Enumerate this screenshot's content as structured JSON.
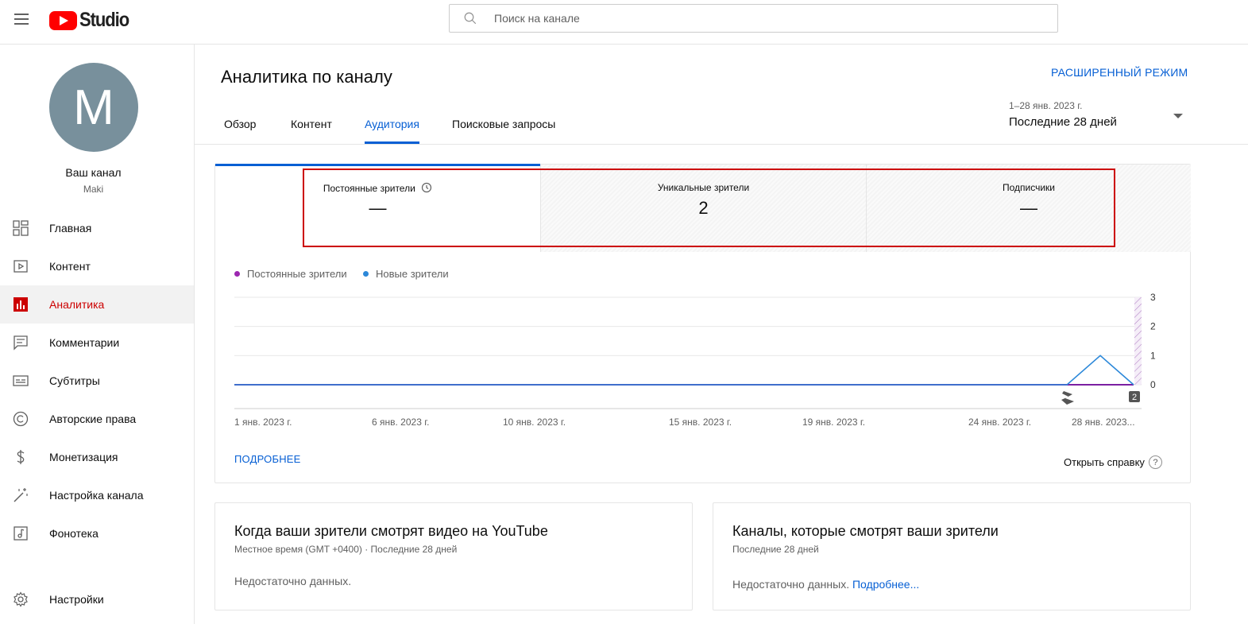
{
  "header": {
    "logo_text": "Studio",
    "search_placeholder": "Поиск на канале"
  },
  "sidebar": {
    "avatar_letter": "M",
    "channel_title": "Ваш канал",
    "channel_name": "Maki",
    "items": [
      {
        "label": "Главная"
      },
      {
        "label": "Контент"
      },
      {
        "label": "Аналитика"
      },
      {
        "label": "Комментарии"
      },
      {
        "label": "Субтитры"
      },
      {
        "label": "Авторские права"
      },
      {
        "label": "Монетизация"
      },
      {
        "label": "Настройка канала"
      },
      {
        "label": "Фонотека"
      },
      {
        "label": "Настройки"
      }
    ],
    "active_index": 2
  },
  "main": {
    "title": "Аналитика по каналу",
    "advanced_mode": "РАСШИРЕННЫЙ РЕЖИМ",
    "tabs": [
      {
        "label": "Обзор"
      },
      {
        "label": "Контент"
      },
      {
        "label": "Аудитория"
      },
      {
        "label": "Поисковые запросы"
      }
    ],
    "active_tab": 2,
    "date_range": "1–28 янв. 2023 г.",
    "date_label": "Последние 28 дней"
  },
  "metrics": [
    {
      "label": "Постоянные зрители",
      "value": "—"
    },
    {
      "label": "Уникальные зрители",
      "value": "2"
    },
    {
      "label": "Подписчики",
      "value": "—"
    }
  ],
  "legend": [
    {
      "name": "Постоянные зрители",
      "color": "#9c27b0"
    },
    {
      "name": "Новые зрители",
      "color": "#2c88d9"
    }
  ],
  "chart_data": {
    "type": "line",
    "x_ticks": [
      "1 янв. 2023 г.",
      "6 янв. 2023 г.",
      "10 янв. 2023 г.",
      "15 янв. 2023 г.",
      "19 янв. 2023 г.",
      "24 янв. 2023 г.",
      "28 янв. 2023..."
    ],
    "y_ticks": [
      "0",
      "1",
      "2",
      "3"
    ],
    "ylim": [
      0,
      3
    ],
    "x": [
      "1 янв.",
      "2 янв.",
      "3 янв.",
      "4 янв.",
      "5 янв.",
      "6 янв.",
      "7 янв.",
      "8 янв.",
      "9 янв.",
      "10 янв.",
      "11 янв.",
      "12 янв.",
      "13 янв.",
      "14 янв.",
      "15 янв.",
      "16 янв.",
      "17 янв.",
      "18 янв.",
      "19 янв.",
      "20 янв.",
      "21 янв.",
      "22 янв.",
      "23 янв.",
      "24 янв.",
      "25 янв.",
      "26 янв.",
      "27 янв.",
      "28 янв."
    ],
    "series": [
      {
        "name": "Постоянные зрители",
        "color": "#7b1fa2",
        "values": [
          0,
          0,
          0,
          0,
          0,
          0,
          0,
          0,
          0,
          0,
          0,
          0,
          0,
          0,
          0,
          0,
          0,
          0,
          0,
          0,
          0,
          0,
          0,
          0,
          0,
          0,
          0,
          0
        ]
      },
      {
        "name": "Новые зрители",
        "color": "#2c88d9",
        "values": [
          0,
          0,
          0,
          0,
          0,
          0,
          0,
          0,
          0,
          0,
          0,
          0,
          0,
          0,
          0,
          0,
          0,
          0,
          0,
          0,
          0,
          0,
          0,
          0,
          0,
          0,
          1,
          0
        ]
      }
    ],
    "marker_badge": "2"
  },
  "more_link": "ПОДРОБНЕЕ",
  "help_link": "Открыть справку",
  "help_icon": "?",
  "card_when": {
    "title": "Когда ваши зрители смотрят видео на YouTube",
    "subtitle": "Местное время (GMT +0400) · Последние 28 дней",
    "empty": "Недостаточно данных."
  },
  "card_channels": {
    "title": "Каналы, которые смотрят ваши зрители",
    "subtitle": "Последние 28 дней",
    "empty": "Недостаточно данных.",
    "link": "Подробнее..."
  }
}
